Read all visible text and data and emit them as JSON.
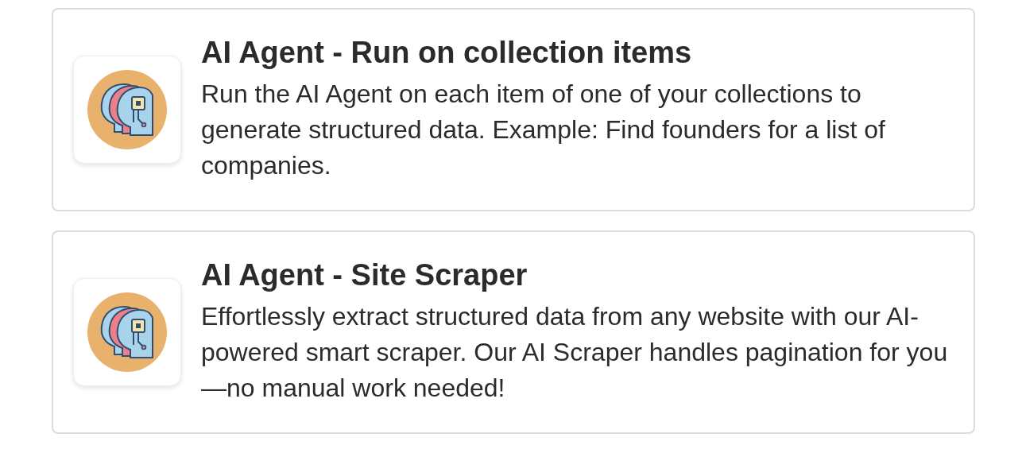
{
  "cards": [
    {
      "title": "AI Agent - Run on collection items",
      "description": "Run the AI Agent on each item of one of your collections to generate structured data. Example: Find founders for a list of companies."
    },
    {
      "title": "AI Agent - Site Scraper",
      "description": "Effortlessly extract structured data from any website with our AI-powered smart scraper. Our AI Scraper handles pagination for you—no manual work needed!"
    }
  ]
}
